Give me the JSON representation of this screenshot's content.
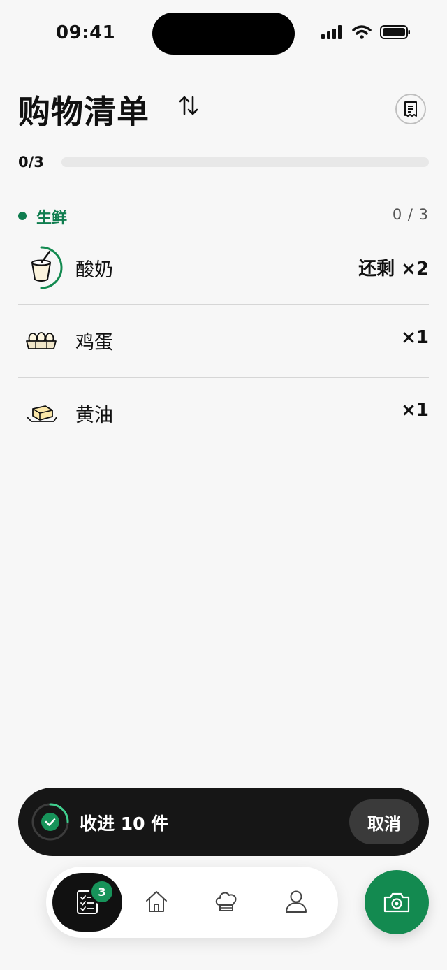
{
  "status_bar": {
    "time": "09:41"
  },
  "header": {
    "title": "购物清单",
    "sort_icon": "sort-arrows-icon",
    "receipt_icon": "receipt-icon"
  },
  "progress": {
    "label": "0/3",
    "fraction": 0
  },
  "section": {
    "label": "生鲜",
    "count": "0 / 3",
    "color": "#0f7d4f",
    "items": [
      {
        "name": "酸奶",
        "qty": "还剩 ×2",
        "icon": "yogurt-icon"
      },
      {
        "name": "鸡蛋",
        "qty": "×1",
        "icon": "egg-carton-icon"
      },
      {
        "name": "黄油",
        "qty": "×1",
        "icon": "butter-icon"
      }
    ]
  },
  "toast": {
    "text": "收进 10 件",
    "cancel_label": "取消"
  },
  "tabbar": {
    "badge": "3",
    "tabs": [
      "checklist-icon",
      "home-icon",
      "chef-hat-icon",
      "profile-icon"
    ]
  },
  "fab": {
    "icon": "camera-icon",
    "color": "#138a50"
  }
}
